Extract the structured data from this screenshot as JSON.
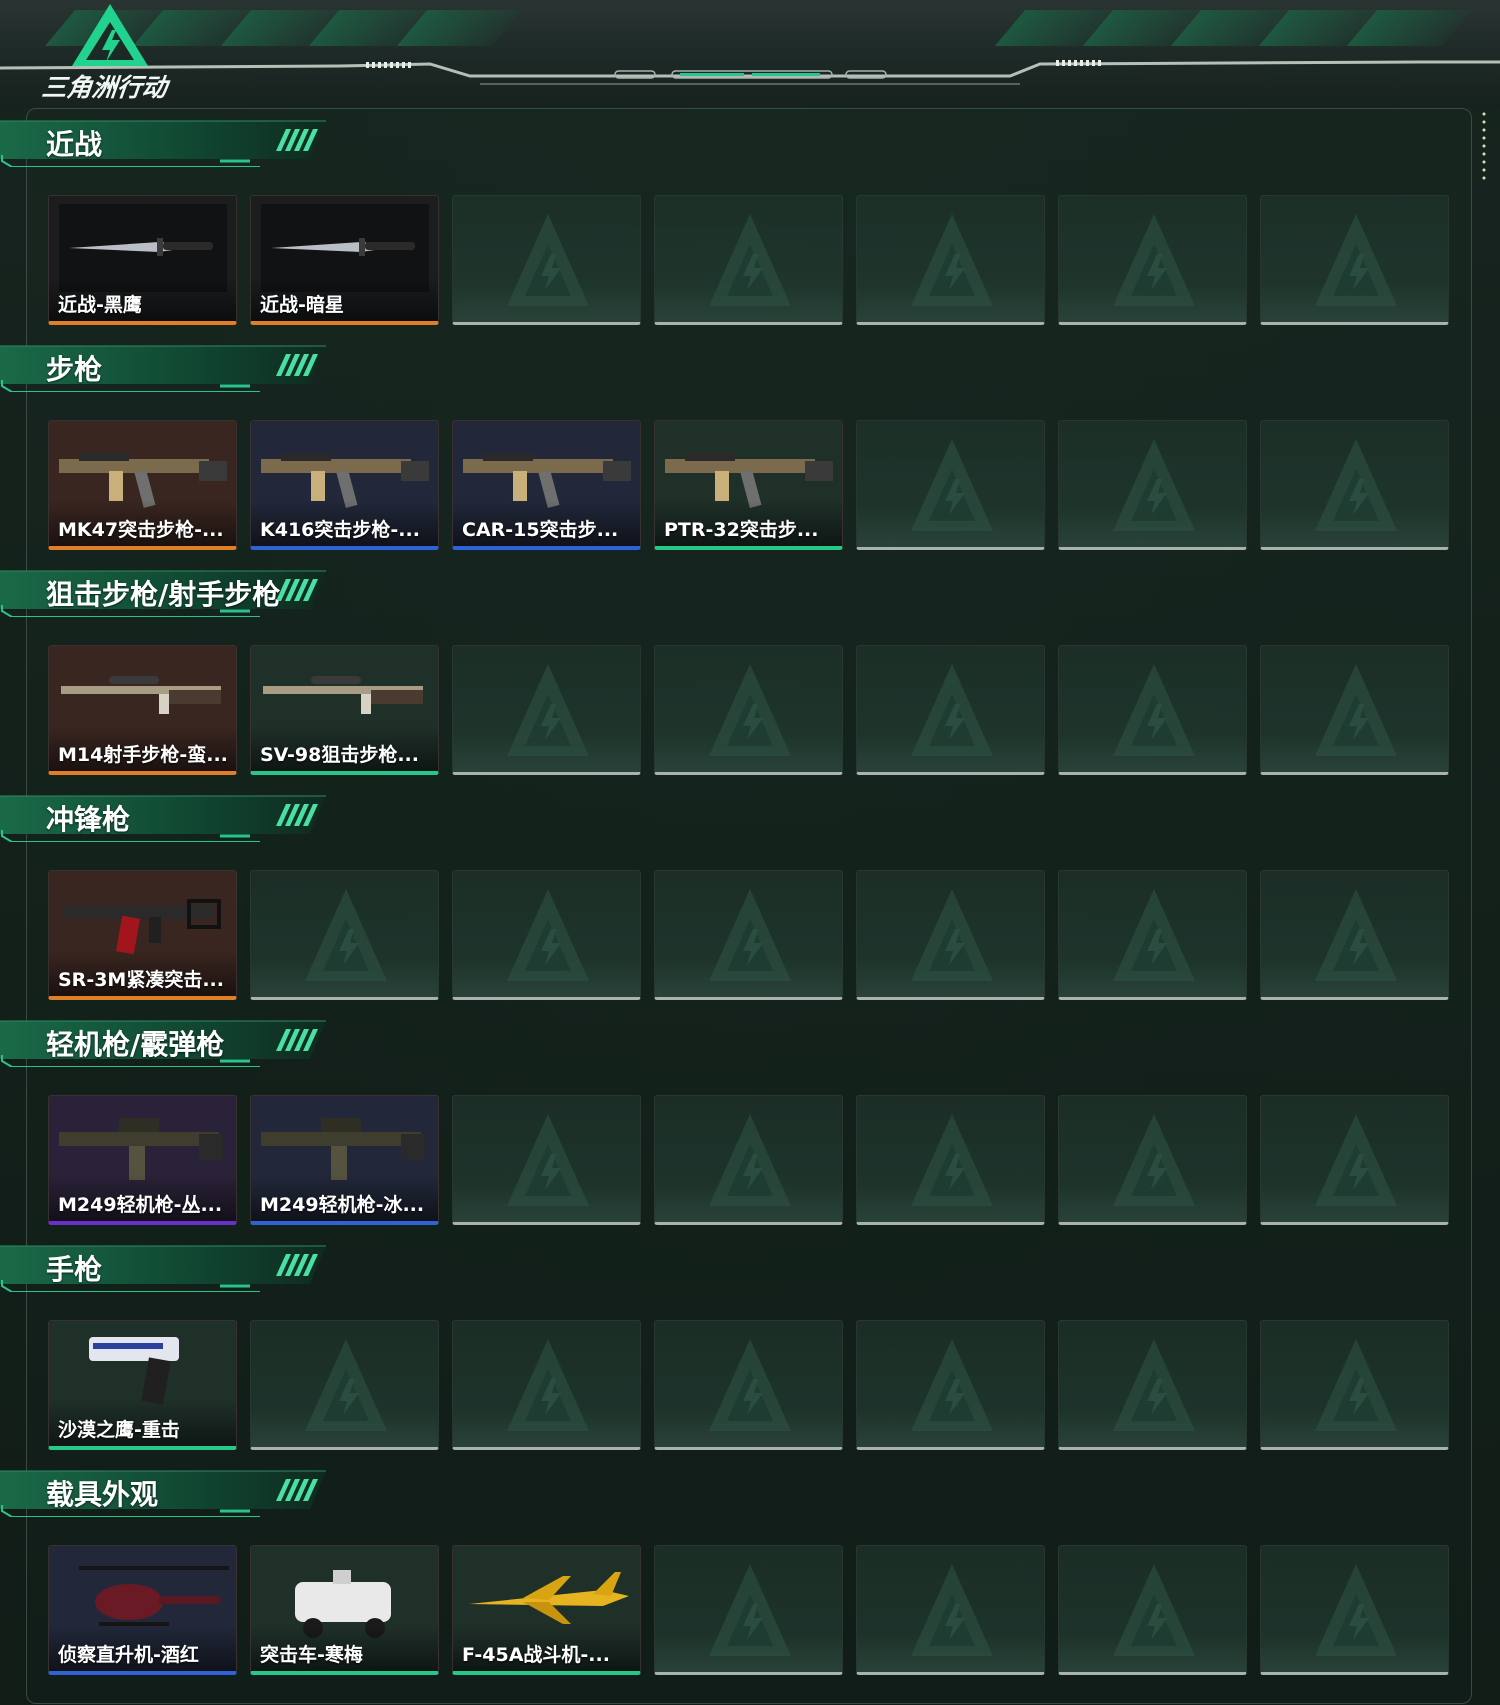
{
  "header": {
    "logo_text": "三角洲行动"
  },
  "colors": {
    "accent_green": "#1fb873",
    "rarity_orange": "#e07f28",
    "rarity_blue": "#2f62d6",
    "rarity_green": "#26c888",
    "rarity_purple": "#6a2fc9",
    "empty_slot": "#a9b2ad"
  },
  "sections": [
    {
      "title": "近战",
      "items": [
        {
          "label": "近战-黑鹰",
          "rarity": "orange",
          "icon": "knife-icon",
          "bg": "#1b1d1f"
        },
        {
          "label": "近战-暗星",
          "rarity": "orange",
          "icon": "knife-icon",
          "bg": "#1b1d1f"
        }
      ]
    },
    {
      "title": "步枪",
      "items": [
        {
          "label": "MK47突击步枪-...",
          "rarity": "orange",
          "icon": "assault-rifle-icon",
          "bg": "#3a2620"
        },
        {
          "label": "K416突击步枪-...",
          "rarity": "blue",
          "icon": "assault-rifle-icon",
          "bg": "#22283a"
        },
        {
          "label": "CAR-15突击步...",
          "rarity": "blue",
          "icon": "assault-rifle-icon",
          "bg": "#22283a"
        },
        {
          "label": "PTR-32突击步...",
          "rarity": "green",
          "icon": "assault-rifle-icon",
          "bg": "#1f3029"
        }
      ]
    },
    {
      "title": "狙击步枪/射手步枪",
      "items": [
        {
          "label": "M14射手步枪-蛮...",
          "rarity": "orange",
          "icon": "sniper-rifle-icon",
          "bg": "#3a2620"
        },
        {
          "label": "SV-98狙击步枪...",
          "rarity": "green",
          "icon": "sniper-rifle-icon",
          "bg": "#1f3029"
        }
      ]
    },
    {
      "title": "冲锋枪",
      "items": [
        {
          "label": "SR-3M紧凑突击...",
          "rarity": "orange",
          "icon": "smg-icon",
          "bg": "#3a2620"
        }
      ]
    },
    {
      "title": "轻机枪/霰弹枪",
      "items": [
        {
          "label": "M249轻机枪-丛...",
          "rarity": "purple",
          "icon": "machine-gun-icon",
          "bg": "#2a2238"
        },
        {
          "label": "M249轻机枪-冰...",
          "rarity": "blue",
          "icon": "machine-gun-icon",
          "bg": "#22283a"
        }
      ]
    },
    {
      "title": "手枪",
      "items": [
        {
          "label": "沙漠之鹰-重击",
          "rarity": "green",
          "icon": "pistol-icon",
          "bg": "#1f3029"
        }
      ]
    },
    {
      "title": "载具外观",
      "items": [
        {
          "label": "侦察直升机-酒红",
          "rarity": "blue",
          "icon": "helicopter-icon",
          "bg": "#22283a"
        },
        {
          "label": "突击车-寒梅",
          "rarity": "green",
          "icon": "armored-vehicle-icon",
          "bg": "#1f3029"
        },
        {
          "label": "F-45A战斗机-...",
          "rarity": "green",
          "icon": "fighter-jet-icon",
          "bg": "#1f3029"
        }
      ]
    }
  ]
}
